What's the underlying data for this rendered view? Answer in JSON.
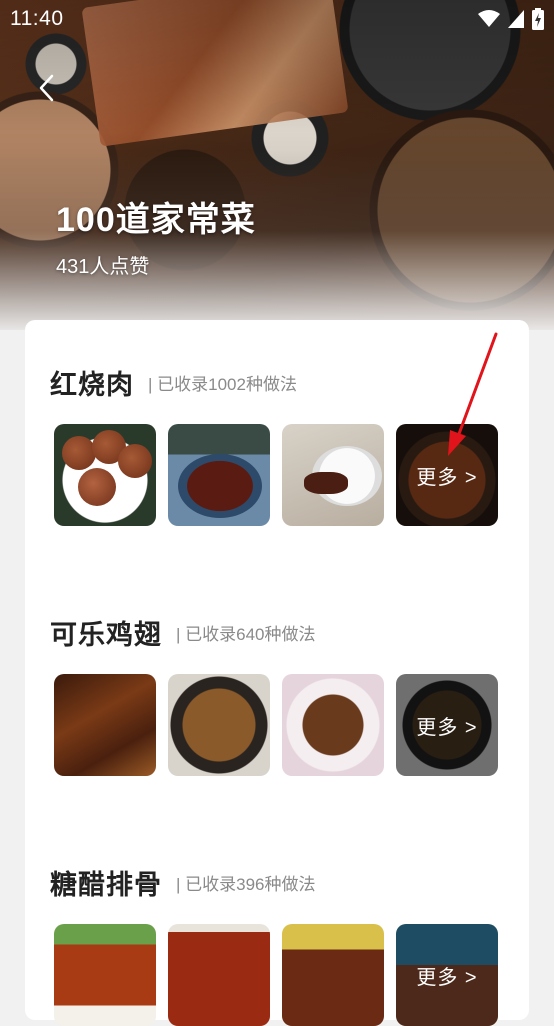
{
  "status_bar": {
    "time": "11:40"
  },
  "header": {
    "title": "100道家常菜",
    "likes": "431人点赞"
  },
  "sections": [
    {
      "title": "红烧肉",
      "count": "| 已收录1002种做法",
      "thumbs": [
        "red-braised-meatballs",
        "braised-pork-cubes",
        "braised-pork-with-rice",
        "clay-pot-pork"
      ],
      "more_label": "更多 >"
    },
    {
      "title": "可乐鸡翅",
      "count": "| 已收录640种做法",
      "thumbs": [
        "cola-wings-plate",
        "cola-wings-pan",
        "cola-wings-flower-plate",
        "cola-wings-cooker"
      ],
      "more_label": "更多 >"
    },
    {
      "title": "糖醋排骨",
      "count": "| 已收录396种做法",
      "thumbs": [
        "sweet-sour-ribs-1",
        "sweet-sour-ribs-2",
        "sweet-sour-ribs-3",
        "sweet-sour-ribs-4"
      ],
      "more_label": "更多 >"
    }
  ],
  "colors": {
    "annotation_arrow": "#e0141a",
    "card_background": "#ffffff",
    "page_background": "#f1f1f1"
  }
}
